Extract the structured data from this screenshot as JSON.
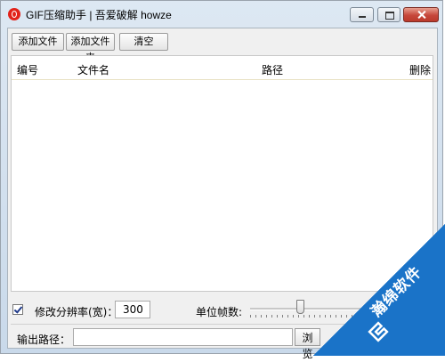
{
  "window": {
    "title": "GIF压缩助手 | 吾爱破解 howze"
  },
  "toolbar": {
    "add_file_label": "添加文件",
    "add_folder_label": "添加文件夹",
    "clear_label": "清空"
  },
  "list": {
    "columns": [
      "编号",
      "文件名",
      "路径",
      "删除"
    ],
    "rows": []
  },
  "options": {
    "modify_resolution_label": "修改分辨率(宽)：",
    "modify_resolution_checked": true,
    "resolution_width": "300",
    "unit_fps_label": "单位帧数:",
    "fps_slider_fraction": 0.28
  },
  "output": {
    "path_label": "输出路径：",
    "path_value": "",
    "browse_label": "浏览"
  },
  "watermark": {
    "text": "瀚绵软件",
    "color": "#1a73c8"
  }
}
